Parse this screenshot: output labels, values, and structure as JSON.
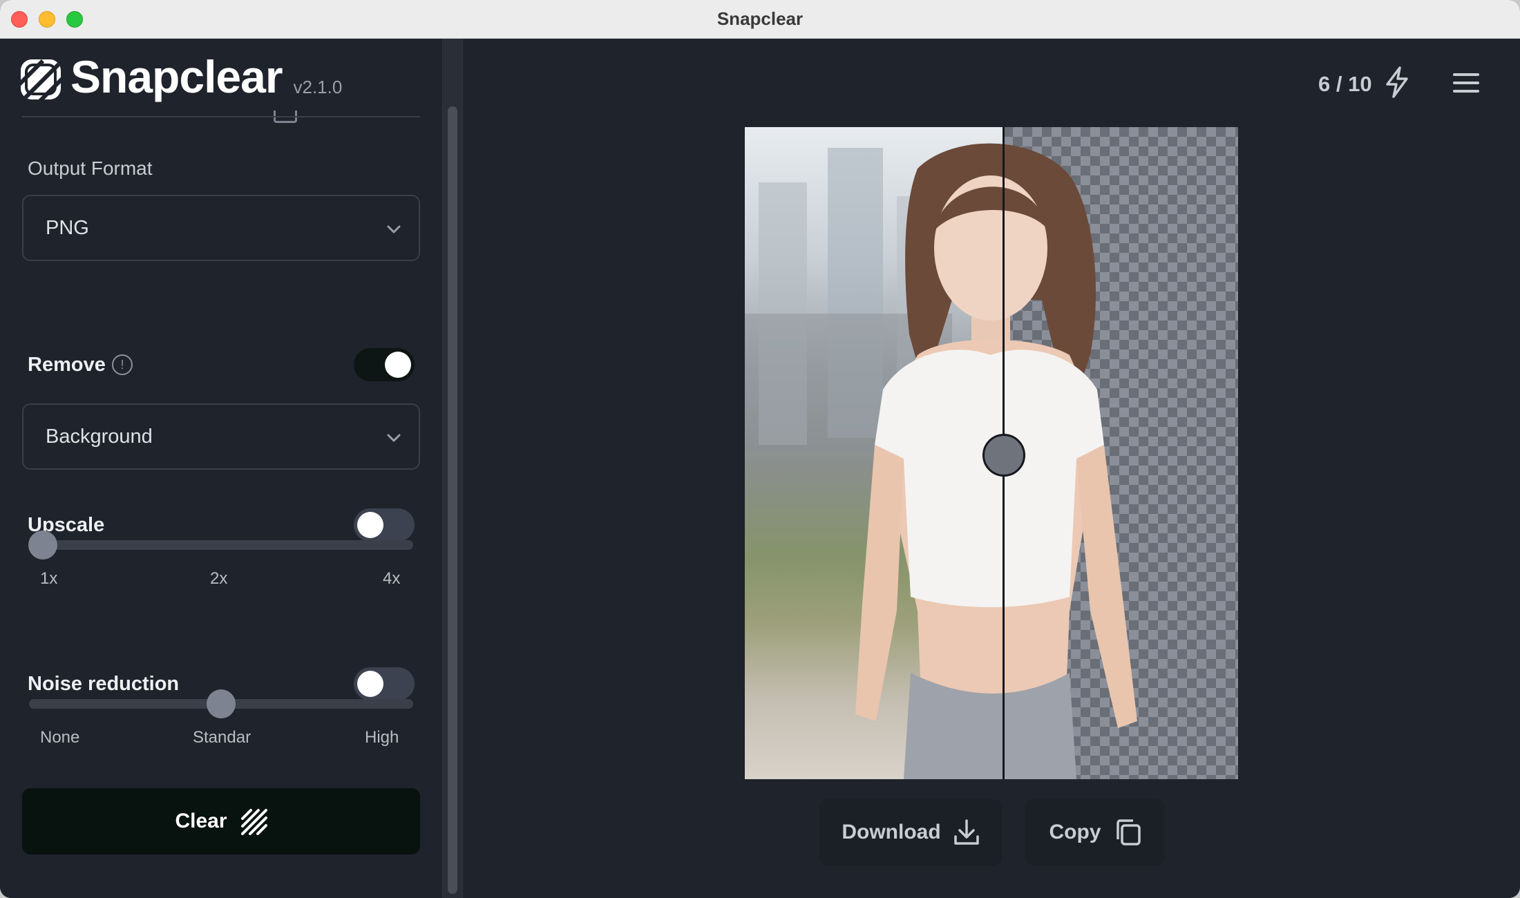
{
  "window": {
    "title": "Snapclear"
  },
  "brand": {
    "name": "Snapclear",
    "version": "v2.1.0"
  },
  "sidebar": {
    "output_format": {
      "label": "Output Format",
      "value": "PNG"
    },
    "remove": {
      "label": "Remove",
      "enabled": true,
      "value": "Background"
    },
    "upscale": {
      "label": "Upscale",
      "enabled": false,
      "slider_value": "1x",
      "ticks": [
        "1x",
        "2x",
        "4x"
      ]
    },
    "noise_reduction": {
      "label": "Noise reduction",
      "enabled": false,
      "slider_value": "Standar",
      "ticks": [
        "None",
        "Standar",
        "High"
      ]
    },
    "clear_label": "Clear"
  },
  "main": {
    "counter": "6 / 10",
    "download_label": "Download",
    "copy_label": "Copy"
  },
  "colors": {
    "background": "#1f232b",
    "toggle_on": "#0d1614",
    "toggle_off": "#3c4250",
    "clear_button": "#08130f"
  },
  "icons": [
    "app-logo-icon",
    "chevron-down-icon",
    "info-icon",
    "eraser-stripes-icon",
    "bolt-icon",
    "hamburger-menu-icon",
    "download-icon",
    "copy-icon"
  ]
}
